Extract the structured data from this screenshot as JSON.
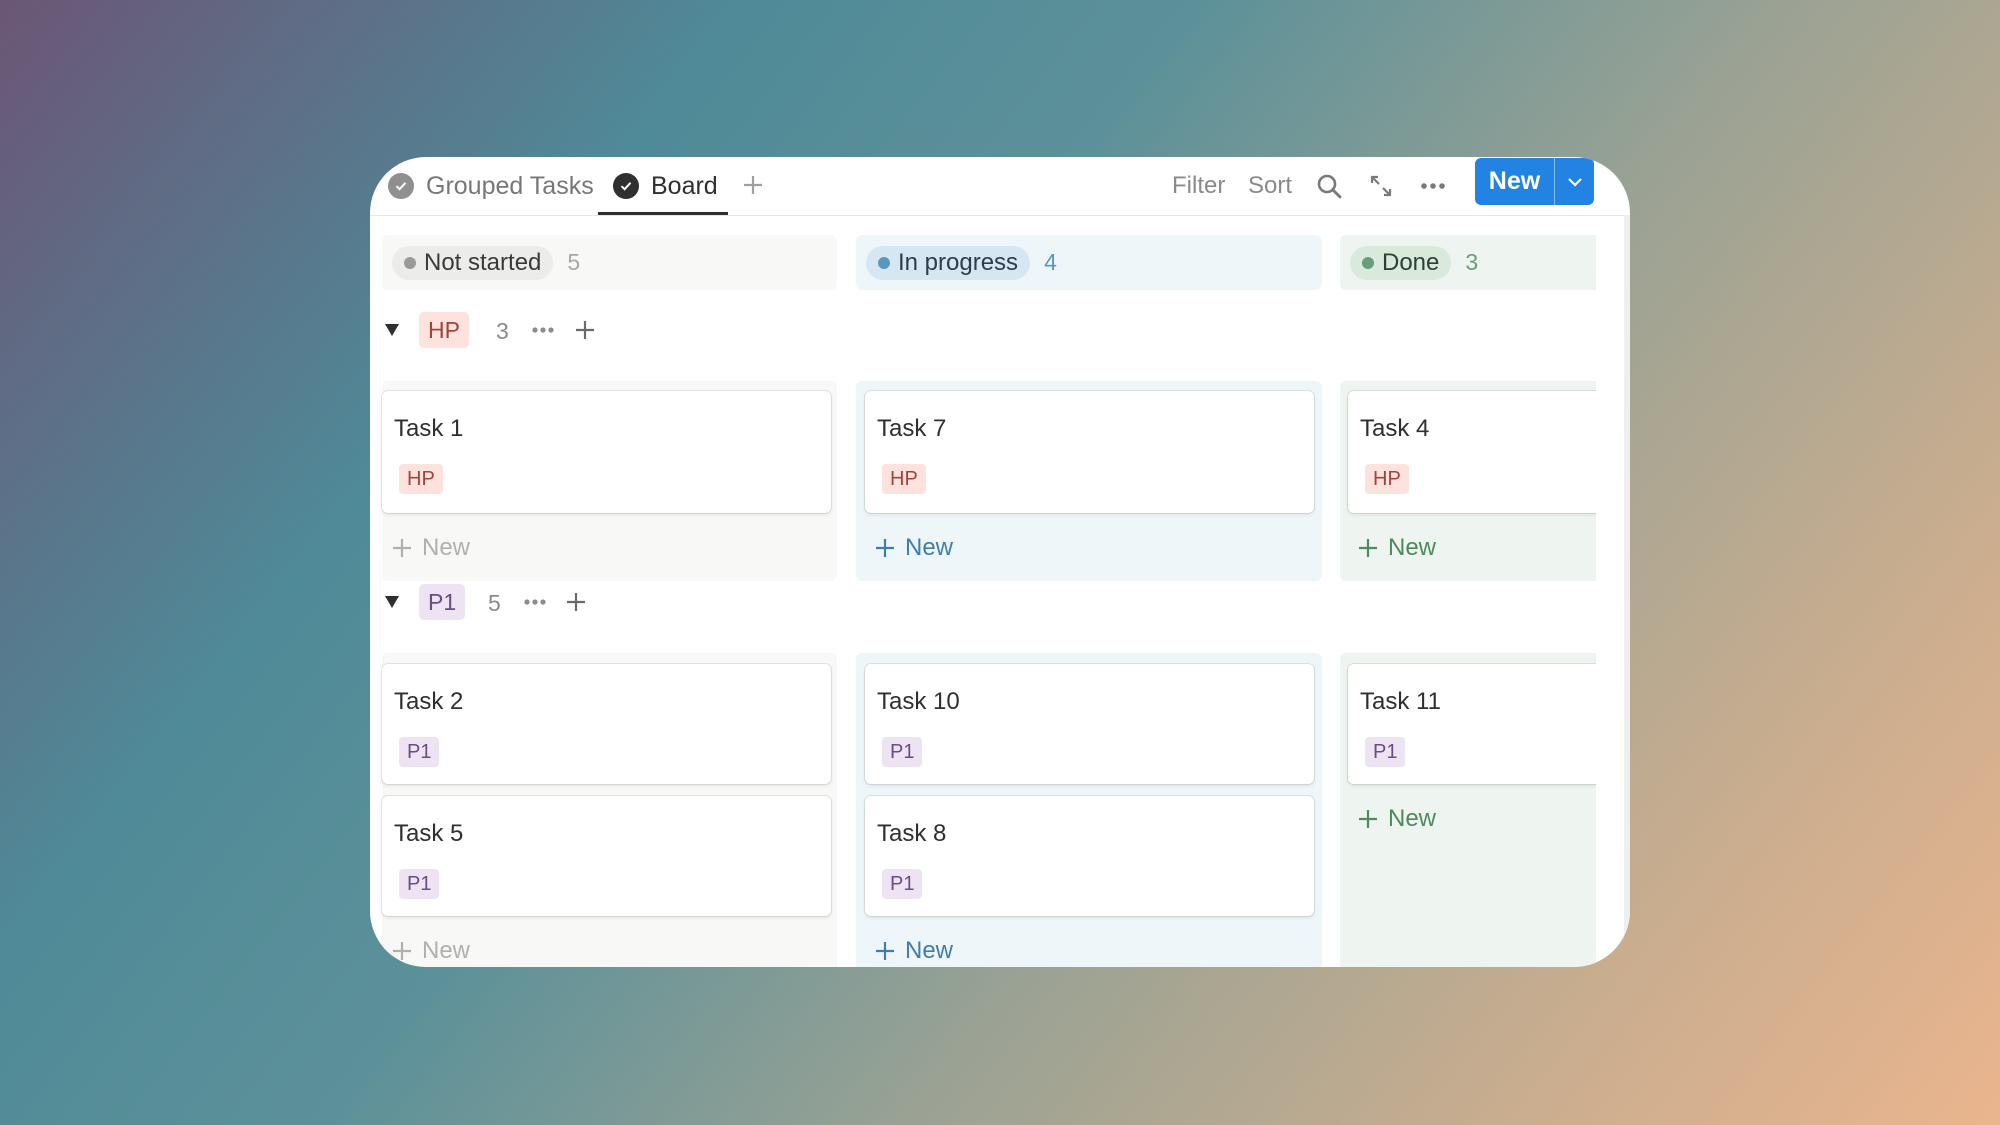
{
  "tabs": [
    {
      "label": "Grouped Tasks"
    },
    {
      "label": "Board"
    }
  ],
  "toolbar": {
    "filter_label": "Filter",
    "sort_label": "Sort",
    "new_label": "New"
  },
  "columns": [
    {
      "status": "Not started",
      "count": "5"
    },
    {
      "status": "In progress",
      "count": "4"
    },
    {
      "status": "Done",
      "count": "3"
    }
  ],
  "groups": [
    {
      "tag": "HP",
      "count": "3",
      "cards": {
        "not_started": [
          {
            "title": "Task 1",
            "tag": "HP"
          }
        ],
        "in_progress": [
          {
            "title": "Task 7",
            "tag": "HP"
          }
        ],
        "done": [
          {
            "title": "Task 4",
            "tag": "HP"
          }
        ]
      }
    },
    {
      "tag": "P1",
      "count": "5",
      "cards": {
        "not_started": [
          {
            "title": "Task 2",
            "tag": "P1"
          },
          {
            "title": "Task 5",
            "tag": "P1"
          }
        ],
        "in_progress": [
          {
            "title": "Task 10",
            "tag": "P1"
          },
          {
            "title": "Task 8",
            "tag": "P1"
          }
        ],
        "done": [
          {
            "title": "Task 11",
            "tag": "P1"
          }
        ]
      }
    }
  ],
  "new_card_label": "New",
  "colors": {
    "accent": "#2383e2",
    "not_started_dot": "#9b9a97",
    "in_progress_dot": "#5b97bd",
    "done_dot": "#6c9b7d",
    "hp_tag_bg": "#fde2de",
    "p1_tag_bg": "#eee3f2"
  },
  "icons": [
    "check-circle-icon",
    "plus-icon",
    "search-icon",
    "expand-icon",
    "more-icon",
    "chevron-down-icon",
    "triangle-down-icon"
  ]
}
